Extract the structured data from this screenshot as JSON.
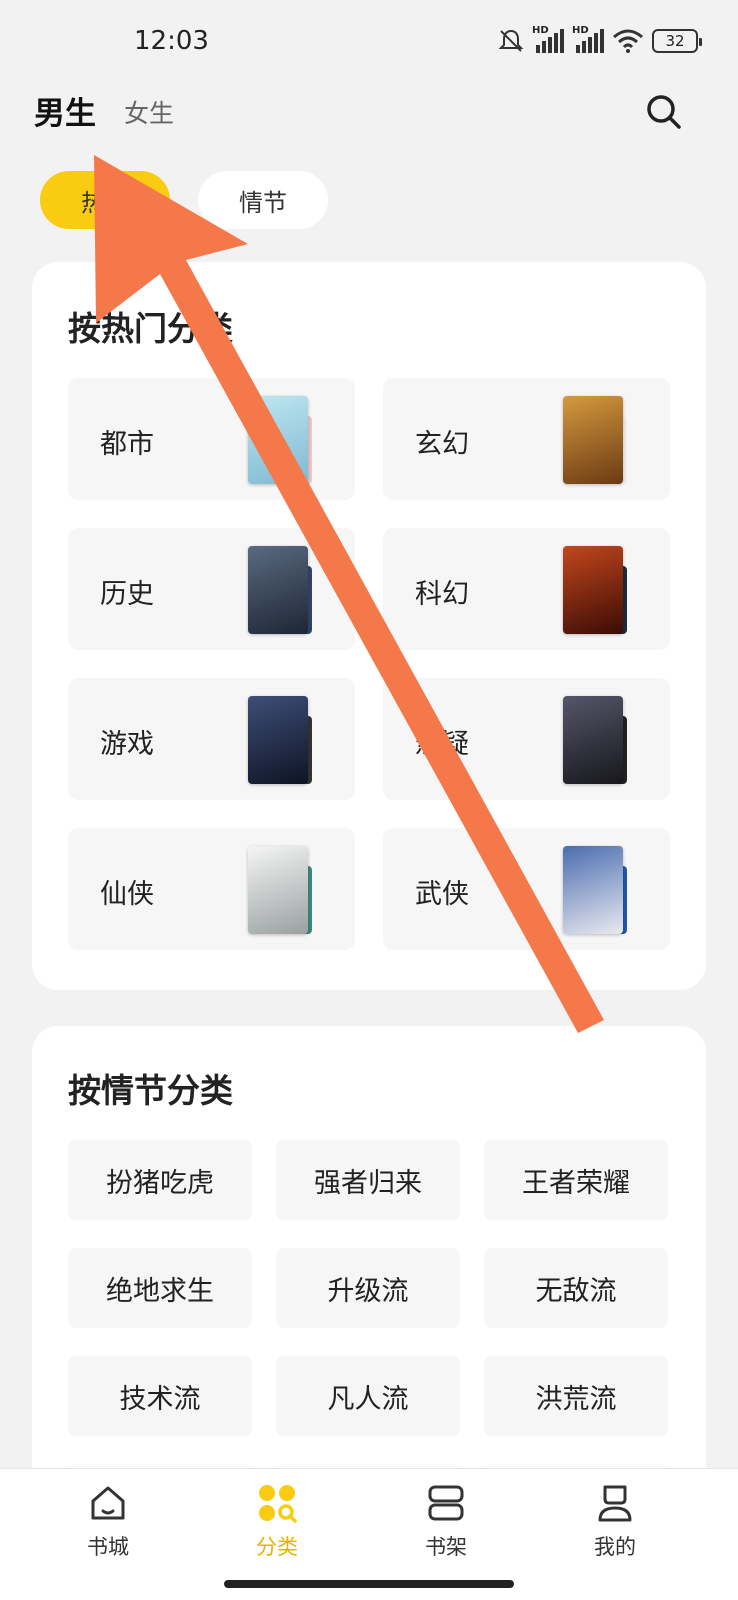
{
  "status_bar": {
    "time": "12:03",
    "hd_label": "HD",
    "battery": "32",
    "icons": [
      "mute-icon",
      "signal-icon",
      "signal-icon",
      "wifi-icon",
      "battery-icon"
    ]
  },
  "top_nav": {
    "tab_male": "男生",
    "tab_female": "女生",
    "search_icon": "search-icon"
  },
  "filter_chips": [
    {
      "label": "热门",
      "active": true
    },
    {
      "label": "情节",
      "active": false
    }
  ],
  "hot_section": {
    "title": "按热门分类",
    "categories": [
      {
        "label": "都市",
        "cover_color": "#9fd3e3",
        "back_color": "#e8c8c8"
      },
      {
        "label": "玄幻",
        "cover_color": "#b1762e",
        "back_color": "#eeeeee"
      },
      {
        "label": "历史",
        "cover_color": "#3a4a5c",
        "back_color": "#334466"
      },
      {
        "label": "科幻",
        "cover_color": "#7a2610",
        "back_color": "#1d2a3a"
      },
      {
        "label": "游戏",
        "cover_color": "#1f2a44",
        "back_color": "#333333"
      },
      {
        "label": "悬疑",
        "cover_color": "#2b2b33",
        "back_color": "#222222"
      },
      {
        "label": "仙侠",
        "cover_color": "#dcdcdc",
        "back_color": "#3c8a7e"
      },
      {
        "label": "武侠",
        "cover_color": "#2d4e8a",
        "back_color": "#2255aa"
      }
    ]
  },
  "plot_section": {
    "title": "按情节分类",
    "tags": [
      "扮猪吃虎",
      "强者归来",
      "王者荣耀",
      "绝地求生",
      "升级流",
      "无敌流",
      "技术流",
      "凡人流",
      "洪荒流"
    ]
  },
  "bottom_nav": {
    "items": [
      {
        "label": "书城",
        "icon": "home-icon",
        "active": false
      },
      {
        "label": "分类",
        "icon": "category-icon",
        "active": true
      },
      {
        "label": "书架",
        "icon": "bookshelf-icon",
        "active": false
      },
      {
        "label": "我的",
        "icon": "profile-icon",
        "active": false
      }
    ]
  },
  "colors": {
    "accent": "#f9cc12",
    "active_nav_text": "#e3b400",
    "annotation_arrow": "#f5784a",
    "background": "#f2f2f2"
  }
}
